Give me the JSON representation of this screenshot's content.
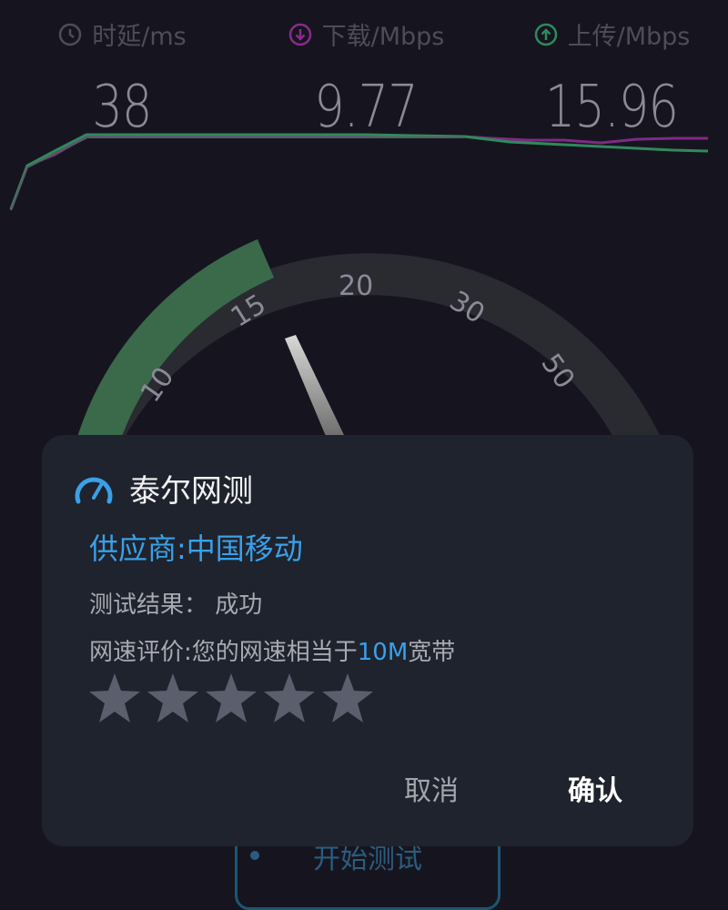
{
  "metrics": [
    {
      "label": "时延/ms",
      "value": "38",
      "icon": "clock-icon",
      "color": "#4d4c58"
    },
    {
      "label": "下载/Mbps",
      "value": "9.77",
      "icon": "download-icon",
      "color": "#8a2a8c"
    },
    {
      "label": "上传/Mbps",
      "value": "15.96",
      "icon": "upload-icon",
      "color": "#2f8a5a"
    }
  ],
  "gauge": {
    "ticks": [
      "10",
      "15",
      "20",
      "30",
      "50"
    ],
    "arc_color": "#3a6a4a",
    "track_color": "#2a2a31"
  },
  "start_button": {
    "label": "开始测试"
  },
  "dialog": {
    "title": "泰尔网测",
    "provider": "供应商:中国移动",
    "result": "测试结果：  成功",
    "rating_prefix": "网速评价:您的网速相当于",
    "rating_value": "10M",
    "rating_suffix": "宽带",
    "stars_total": 5,
    "stars_filled": 0,
    "cancel": "取消",
    "confirm": "确认"
  },
  "colors": {
    "accent": "#3aa0e8",
    "background": "#16151f",
    "dialog": "#1f232d"
  }
}
